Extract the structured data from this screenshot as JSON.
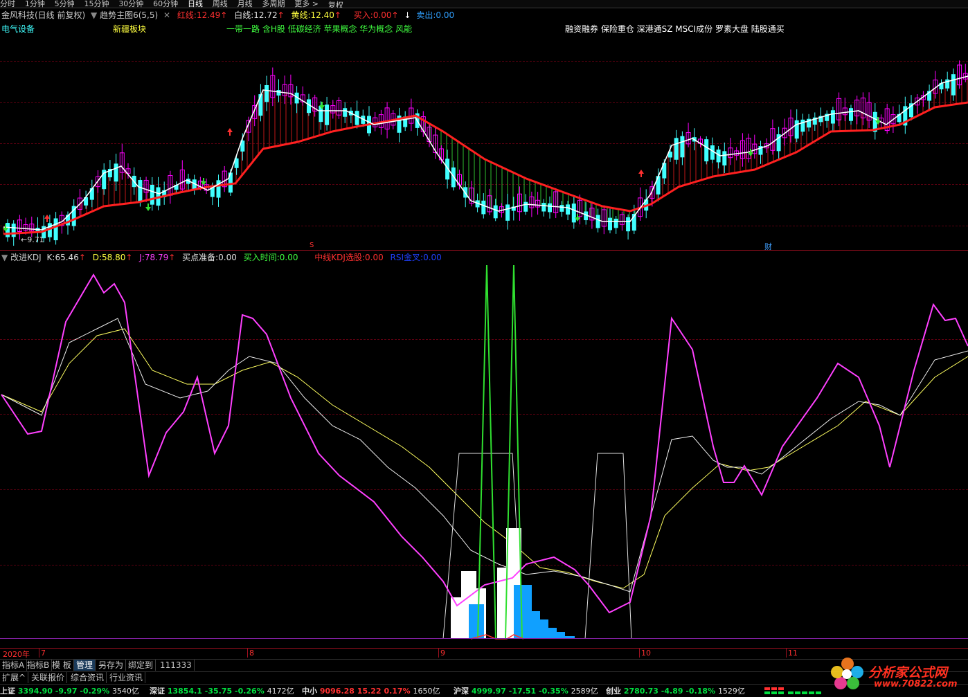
{
  "menu": {
    "tabs": [
      "分时",
      "1分钟",
      "5分钟",
      "15分钟",
      "30分钟",
      "60分钟",
      "日线",
      "周线",
      "月线",
      "多周期",
      "更多 >"
    ],
    "active_index": 6,
    "right_label": "复权"
  },
  "main_chart": {
    "stock_title": "金风科技(日线 前复权)",
    "indicator_name": "趋势主图6(5,5)",
    "red_line_label": "红线:",
    "red_line_value": "12.49",
    "white_line_label": "白线:",
    "white_line_value": "12.72",
    "yellow_line_label": "黄线:",
    "yellow_line_value": "12.40",
    "buy_label": "买入:",
    "buy_value": "0.00",
    "sell_label": "卖出:",
    "sell_value": "0.00",
    "tag_sector": "电气设备",
    "tag_region": "新疆板块",
    "tag_concepts": "一带一路 含H股 低碳经济 苹果概念 华为概念 风能",
    "tag_features": "融资融券 保险重仓 深港通SZ MSCI成份 罗素大盘 陆股通买",
    "low_price_label": "←9.71",
    "marker_s": "S",
    "marker_cai": "财",
    "colors": {
      "up": "#ff00ff",
      "down": "#40ffff",
      "red_line": "#ff2020",
      "white_line": "#ffffff"
    }
  },
  "sub_chart": {
    "indicator_name": "改进KDJ",
    "k_label": "K:",
    "k_value": "65.46",
    "d_label": "D:",
    "d_value": "58.80",
    "j_label": "J:",
    "j_value": "78.79",
    "buy_prep_label": "买点准备:",
    "buy_prep_value": "0.00",
    "buy_time_label": "买入时间:",
    "buy_time_value": "0.00",
    "mid_kdj_label": "中线KDJ选股:",
    "mid_kdj_value": "0.00",
    "rsi_label": "RSI金叉:",
    "rsi_value": "0.00"
  },
  "date_axis": {
    "year": "2020年",
    "months": [
      "7",
      "8",
      "9",
      "10",
      "11"
    ]
  },
  "toolbar": {
    "items": [
      "指标A",
      "指标B",
      "模 板",
      "管理",
      "另存为",
      "绑定到",
      "111333"
    ],
    "selected_index": 3
  },
  "bottom_tabs": [
    "扩展^",
    "关联报价",
    "综合资讯",
    "行业资讯"
  ],
  "tickers": [
    {
      "name": "上证",
      "price": "3394.90",
      "chg": "-9.97",
      "pct": "-0.29%",
      "vol": "3540亿"
    },
    {
      "name": "深证",
      "price": "13854.1",
      "chg": "-35.75",
      "pct": "-0.26%",
      "vol": "4172亿"
    },
    {
      "name": "中小",
      "price": "9096.28",
      "chg": "15.22",
      "pct": "0.17%",
      "vol": "1650亿"
    },
    {
      "name": "沪深",
      "price": "4999.97",
      "chg": "-17.51",
      "pct": "-0.35%",
      "vol": "2589亿"
    },
    {
      "name": "创业",
      "price": "2780.73",
      "chg": "-4.89",
      "pct": "-0.18%",
      "vol": "1529亿"
    }
  ],
  "watermark": {
    "site_name": "分析家公式网",
    "url": "www.70822.com"
  }
}
